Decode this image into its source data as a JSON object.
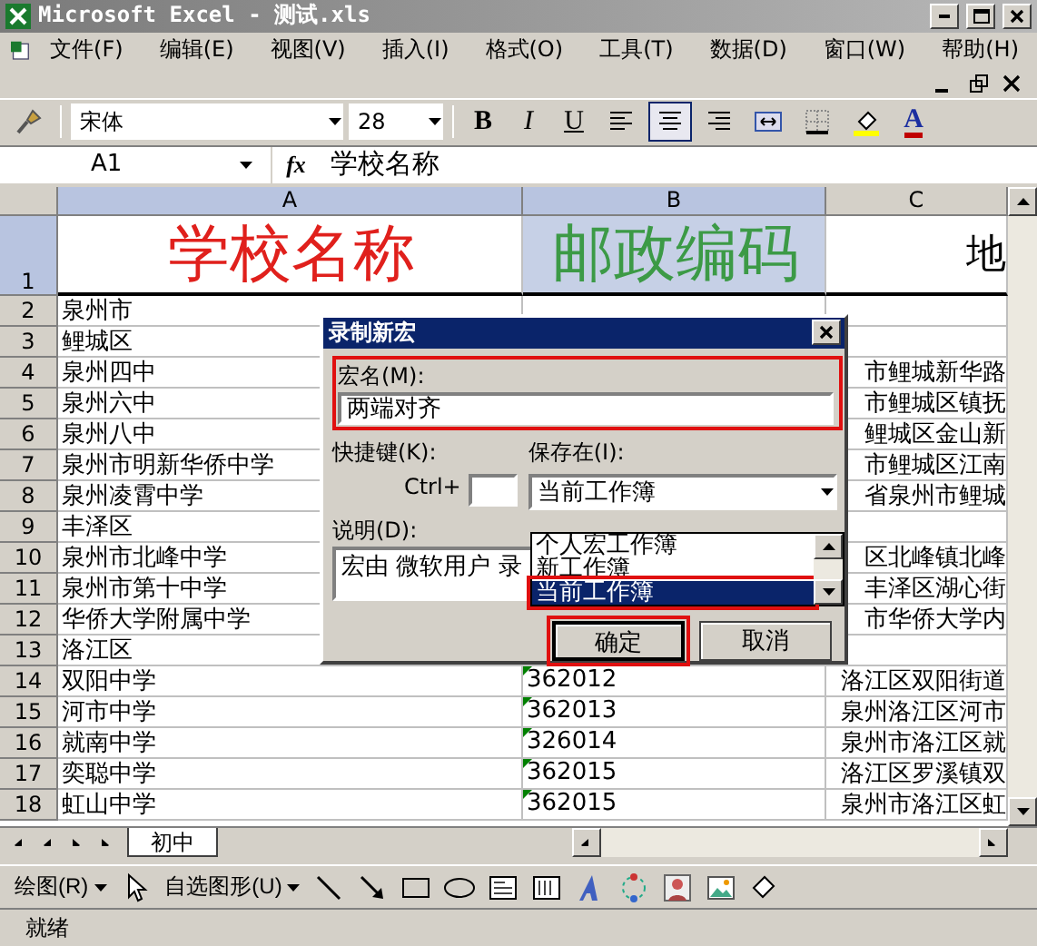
{
  "window": {
    "title": "Microsoft Excel - 测试.xls"
  },
  "menu": [
    "文件(F)",
    "编辑(E)",
    "视图(V)",
    "插入(I)",
    "格式(O)",
    "工具(T)",
    "数据(D)",
    "窗口(W)",
    "帮助(H)"
  ],
  "toolbar": {
    "font": "宋体",
    "size": "28",
    "buttons": [
      {
        "kind": "bold",
        "label": "B",
        "pressed": false
      },
      {
        "kind": "italic",
        "label": "I",
        "pressed": false
      },
      {
        "kind": "underline",
        "label": "U",
        "pressed": false
      },
      {
        "kind": "align_left",
        "pressed": false
      },
      {
        "kind": "align_center",
        "pressed": true
      },
      {
        "kind": "align_right",
        "pressed": false
      },
      {
        "kind": "merge",
        "pressed": false
      },
      {
        "kind": "borders",
        "pressed": false
      },
      {
        "kind": "fill_color",
        "pressed": false
      },
      {
        "kind": "font_color",
        "label": "A",
        "pressed": false
      }
    ]
  },
  "formula_bar": {
    "name_box": "A1",
    "function_label": "fx",
    "value": "学校名称"
  },
  "columns": [
    {
      "label": "A",
      "selected": true
    },
    {
      "label": "B",
      "selected": true
    },
    {
      "label": "C",
      "selected": false
    }
  ],
  "rows": [
    {
      "number": "1",
      "kind": "heading",
      "selected": true,
      "cells": [
        {
          "text": "学校名称",
          "color": "#e0201c",
          "selected": false
        },
        {
          "text": "邮政编码",
          "color": "#3c9a46",
          "selected": true
        },
        {
          "text": "地",
          "color": "#000000",
          "selected": false
        }
      ]
    },
    {
      "number": "2",
      "kind": "data",
      "selected": false,
      "number_as_text": false,
      "cells": [
        "泉州市",
        "",
        ""
      ]
    },
    {
      "number": "3",
      "kind": "data",
      "selected": false,
      "cells": [
        "鲤城区",
        "",
        ""
      ]
    },
    {
      "number": "4",
      "kind": "data",
      "selected": false,
      "cells": [
        "泉州四中",
        "",
        "市鲤城新华路"
      ]
    },
    {
      "number": "5",
      "kind": "data",
      "selected": false,
      "cells": [
        "泉州六中",
        "",
        "市鲤城区镇抚"
      ]
    },
    {
      "number": "6",
      "kind": "data",
      "selected": false,
      "cells": [
        "泉州八中",
        "",
        "鲤城区金山新"
      ]
    },
    {
      "number": "7",
      "kind": "data",
      "selected": false,
      "cells": [
        "泉州市明新华侨中学",
        "",
        "市鲤城区江南"
      ]
    },
    {
      "number": "8",
      "kind": "data",
      "selected": false,
      "cells": [
        "泉州凌霄中学",
        "",
        "省泉州市鲤城"
      ]
    },
    {
      "number": "9",
      "kind": "data",
      "selected": false,
      "cells": [
        "丰泽区",
        "",
        ""
      ]
    },
    {
      "number": "10",
      "kind": "data",
      "selected": false,
      "cells": [
        "泉州市北峰中学",
        "",
        "区北峰镇北峰"
      ]
    },
    {
      "number": "11",
      "kind": "data",
      "selected": false,
      "cells": [
        "泉州市第十中学",
        "",
        "丰泽区湖心街"
      ]
    },
    {
      "number": "12",
      "kind": "data",
      "selected": false,
      "cells": [
        "华侨大学附属中学",
        "",
        "市华侨大学内"
      ]
    },
    {
      "number": "13",
      "kind": "data",
      "selected": false,
      "cells": [
        "洛江区",
        "",
        ""
      ]
    },
    {
      "number": "14",
      "kind": "data",
      "selected": false,
      "number_as_text": true,
      "cells": [
        "双阳中学",
        "362012",
        "洛江区双阳街道"
      ]
    },
    {
      "number": "15",
      "kind": "data",
      "selected": false,
      "number_as_text": true,
      "cells": [
        "河市中学",
        "362013",
        "泉州洛江区河市"
      ]
    },
    {
      "number": "16",
      "kind": "data",
      "selected": false,
      "number_as_text": true,
      "cells": [
        "就南中学",
        "326014",
        "泉州市洛江区就"
      ]
    },
    {
      "number": "17",
      "kind": "data",
      "selected": false,
      "number_as_text": true,
      "cells": [
        "奕聪中学",
        "362015",
        "洛江区罗溪镇双"
      ]
    },
    {
      "number": "18",
      "kind": "data",
      "selected": false,
      "number_as_text": true,
      "cells": [
        "虹山中学",
        "362015",
        "泉州市洛江区虹"
      ]
    }
  ],
  "dialog": {
    "title": "录制新宏",
    "macro_name": {
      "label": "宏名(M):",
      "value": "两端对齐",
      "highlighted": true
    },
    "shortcut": {
      "label": "快捷键(K):",
      "prefix": "Ctrl+"
    },
    "store_in": {
      "label": "保存在(I):",
      "value": "当前工作簿",
      "expanded": true,
      "options": [
        {
          "label": "个人宏工作簿",
          "selected": false,
          "highlighted": false
        },
        {
          "label": "新工作簿",
          "selected": false,
          "highlighted": false
        },
        {
          "label": "当前工作簿",
          "selected": true,
          "highlighted": true
        }
      ]
    },
    "description": {
      "label": "说明(D):",
      "value": "宏由 微软用户 录"
    },
    "buttons": [
      {
        "label": "确定",
        "default": true,
        "highlighted": true
      },
      {
        "label": "取消",
        "default": false,
        "highlighted": false
      }
    ]
  },
  "sheet_tabs": [
    {
      "label": "初中",
      "selected": true
    }
  ],
  "drawing_toolbar": [
    {
      "kind": "menu",
      "label": "绘图(R)"
    },
    {
      "kind": "pointer"
    },
    {
      "kind": "menu",
      "label": "自选图形(U)"
    },
    {
      "kind": "line"
    },
    {
      "kind": "arrow"
    },
    {
      "kind": "rectangle"
    },
    {
      "kind": "oval"
    },
    {
      "kind": "textbox"
    },
    {
      "kind": "vertical_textbox"
    },
    {
      "kind": "wordart"
    },
    {
      "kind": "diagram"
    },
    {
      "kind": "clipart"
    },
    {
      "kind": "picture"
    },
    {
      "kind": "fill"
    }
  ],
  "status_bar": {
    "text": "就绪"
  }
}
